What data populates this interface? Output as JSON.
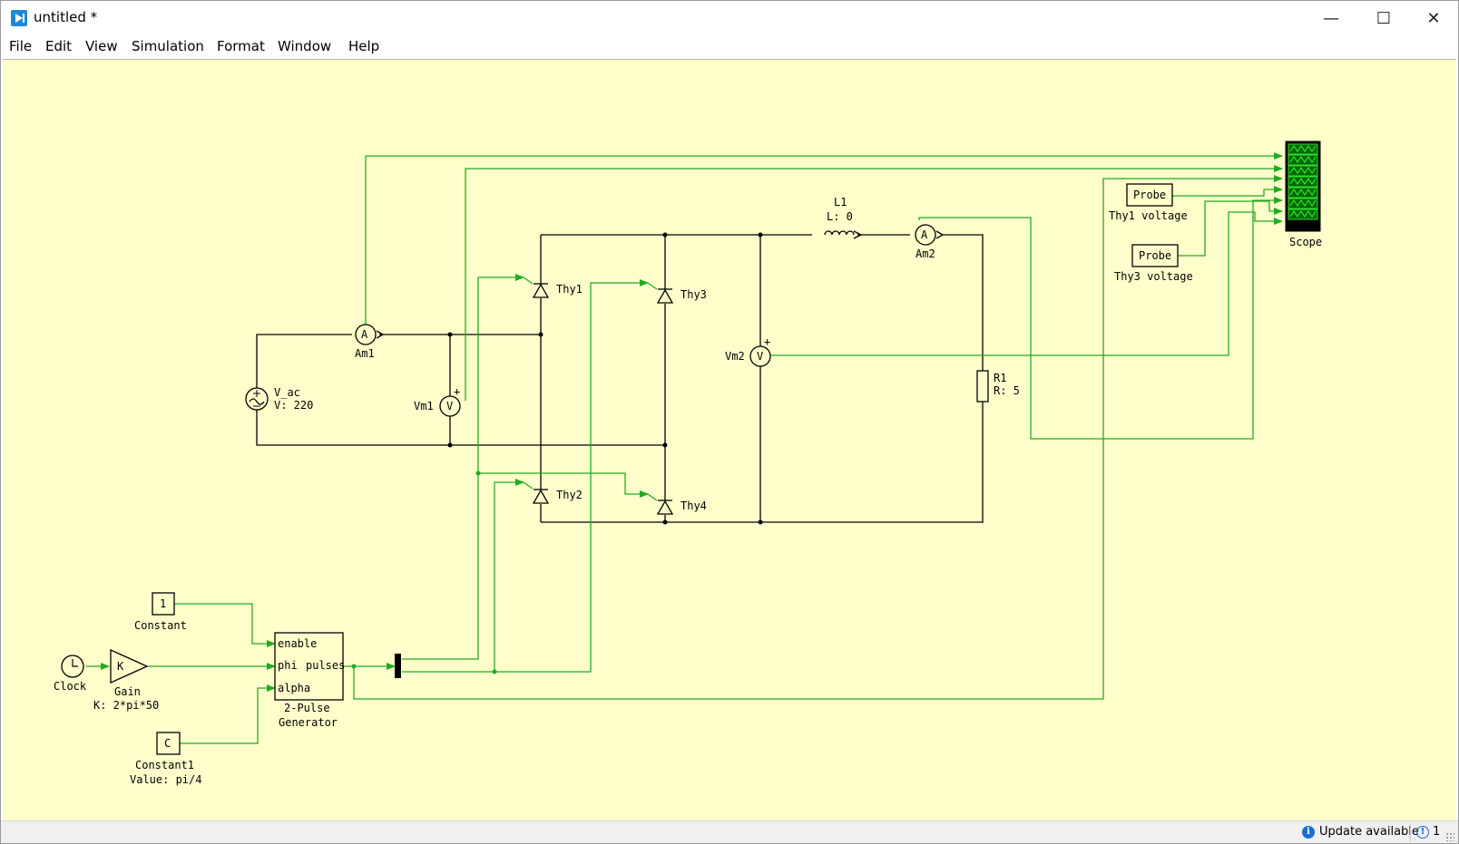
{
  "window": {
    "title": "untitled *",
    "minimize": "—",
    "maximize": "☐",
    "close": "✕"
  },
  "menu": [
    "File",
    "Edit",
    "View",
    "Simulation",
    "Format",
    "Window",
    "Help"
  ],
  "diagram": {
    "scope": "Scope",
    "probe1": {
      "box": "Probe",
      "label": "Thy1 voltage"
    },
    "probe3": {
      "box": "Probe",
      "label": "Thy3 voltage"
    },
    "inductor": {
      "name": "L1",
      "param": "L: 0"
    },
    "am1": {
      "sym": "A",
      "name": "Am1"
    },
    "am2": {
      "sym": "A",
      "name": "Am2"
    },
    "vm1": {
      "sym": "V",
      "name": "Vm1"
    },
    "vm2": {
      "sym": "V",
      "name": "Vm2"
    },
    "source": {
      "name": "V_ac",
      "param": "V: 220"
    },
    "resistor": {
      "name": "R1",
      "param": "R: 5"
    },
    "thy1": "Thy1",
    "thy2": "Thy2",
    "thy3": "Thy3",
    "thy4": "Thy4",
    "constant": {
      "value": "1",
      "name": "Constant"
    },
    "constant1": {
      "value": "C",
      "name": "Constant1",
      "param": "Value: pi/4"
    },
    "clock": {
      "name": "Clock"
    },
    "gain": {
      "sym": "K",
      "name": "Gain",
      "param": "K: 2*pi*50"
    },
    "pulse": {
      "in1": "enable",
      "in2": "phi",
      "in3": "alpha",
      "out": "pulses",
      "name1": "2-Pulse",
      "name2": "Generator"
    }
  },
  "status": {
    "info": "Update available",
    "count": "1"
  },
  "colors": {
    "wire": "#000000",
    "signal": "#22aa22",
    "canvas": "#ffffcc"
  }
}
